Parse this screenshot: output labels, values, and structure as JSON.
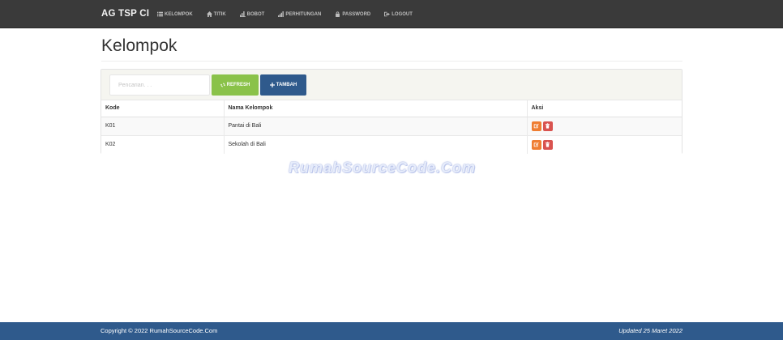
{
  "navbar": {
    "brand": "AG TSP CI",
    "items": [
      {
        "label": "KELOMPOK",
        "icon": "list-icon"
      },
      {
        "label": "TITIK",
        "icon": "home-icon"
      },
      {
        "label": "BOBOT",
        "icon": "bar-chart-icon"
      },
      {
        "label": "PERHITUNGAN",
        "icon": "signal-icon"
      },
      {
        "label": "PASSWORD",
        "icon": "lock-icon"
      },
      {
        "label": "LOGOUT",
        "icon": "logout-icon"
      }
    ]
  },
  "page": {
    "title": "Kelompok"
  },
  "toolbar": {
    "search_placeholder": "Pencarian. . .",
    "search_value": "",
    "refresh_label": "REFRESH",
    "add_label": "TAMBAH"
  },
  "table": {
    "columns": [
      "Kode",
      "Nama Kelompok",
      "Aksi"
    ],
    "rows": [
      {
        "kode": "K01",
        "nama": "Pantai di Bali"
      },
      {
        "kode": "K02",
        "nama": "Sekolah di Bali"
      }
    ]
  },
  "watermark": "RumahSourceCode.Com",
  "footer": {
    "copyright": "Copyright © 2022 RumahSourceCode.Com",
    "updated": "Updated 25 Maret 2022"
  },
  "colors": {
    "navbar": "#3a3a3a",
    "refresh": "#8ac249",
    "primary": "#2f5a8c",
    "edit": "#ef7d32",
    "delete": "#d9534f",
    "footer": "#2f5a8c"
  }
}
